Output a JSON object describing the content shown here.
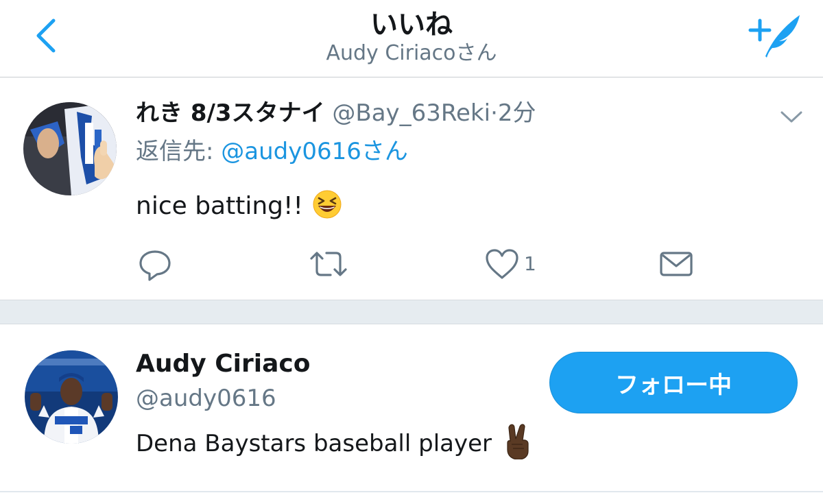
{
  "header": {
    "title": "いいね",
    "subtitle": "Audy Ciriacoさん",
    "back_icon": "chevron-left-icon",
    "compose_icon": "compose-tweet-icon",
    "accent_color": "#1da1f2"
  },
  "tweet": {
    "display_name": "れき 8/3スタナイ",
    "handle": "@Bay_63Reki",
    "separator": "·",
    "time": "2分",
    "reply_prefix": "返信先: ",
    "reply_to": "@audy0616さん",
    "text": "nice batting!!",
    "text_emoji": "laughing-emoji",
    "actions": {
      "reply_icon": "reply-icon",
      "retweet_icon": "retweet-icon",
      "like_icon": "heart-icon",
      "like_count": "1",
      "dm_icon": "envelope-icon"
    }
  },
  "user_card": {
    "name": "Audy Ciriaco",
    "handle": "@audy0616",
    "bio": "Dena Baystars baseball player ",
    "bio_emoji": "victory-hand-emoji",
    "follow_label": "フォロー中"
  },
  "colors": {
    "link": "#1b95e0",
    "muted": "#657786",
    "separator_bg": "#e6ecf0",
    "button": "#1da1f2"
  }
}
